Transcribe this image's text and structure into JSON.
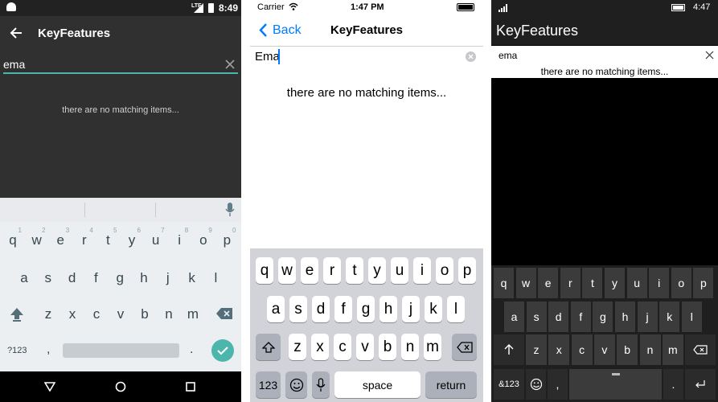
{
  "android": {
    "status": {
      "network": "LTE",
      "time": "8:49"
    },
    "app": {
      "title": "KeyFeatures"
    },
    "search": {
      "value": "ema"
    },
    "message": "there are no matching items...",
    "keyboard": {
      "row1": [
        {
          "k": "q",
          "h": "1"
        },
        {
          "k": "w",
          "h": "2"
        },
        {
          "k": "e",
          "h": "3"
        },
        {
          "k": "r",
          "h": "4"
        },
        {
          "k": "t",
          "h": "5"
        },
        {
          "k": "y",
          "h": "6"
        },
        {
          "k": "u",
          "h": "7"
        },
        {
          "k": "i",
          "h": "8"
        },
        {
          "k": "o",
          "h": "9"
        },
        {
          "k": "p",
          "h": "0"
        }
      ],
      "row2": [
        "a",
        "s",
        "d",
        "f",
        "g",
        "h",
        "j",
        "k",
        "l"
      ],
      "row3": [
        "z",
        "x",
        "c",
        "v",
        "b",
        "n",
        "m"
      ],
      "symbols": "?123",
      "comma": ",",
      "period": ".",
      "accent": "#4db6ac"
    }
  },
  "ios": {
    "status": {
      "carrier": "Carrier",
      "time": "1:47 PM"
    },
    "nav": {
      "back": "Back",
      "title": "KeyFeatures"
    },
    "search": {
      "value": "Ema"
    },
    "message": "there are no matching items...",
    "keyboard": {
      "row1": [
        "q",
        "w",
        "e",
        "r",
        "t",
        "y",
        "u",
        "i",
        "o",
        "p"
      ],
      "row2": [
        "a",
        "s",
        "d",
        "f",
        "g",
        "h",
        "j",
        "k",
        "l"
      ],
      "row3": [
        "z",
        "x",
        "c",
        "v",
        "b",
        "n",
        "m"
      ],
      "numbers": "123",
      "space": "space",
      "return": "return",
      "accent": "#007aff"
    }
  },
  "windows": {
    "status": {
      "time": "4:47"
    },
    "app": {
      "title": "KeyFeatures"
    },
    "search": {
      "value": "ema"
    },
    "message": "there are no matching items...",
    "keyboard": {
      "row1": [
        "q",
        "w",
        "e",
        "r",
        "t",
        "y",
        "u",
        "i",
        "o",
        "p"
      ],
      "row2": [
        "a",
        "s",
        "d",
        "f",
        "g",
        "h",
        "j",
        "k",
        "l"
      ],
      "row3": [
        "z",
        "x",
        "c",
        "v",
        "b",
        "n",
        "m"
      ],
      "symbols": "&123",
      "comma": ",",
      "period": "."
    }
  }
}
